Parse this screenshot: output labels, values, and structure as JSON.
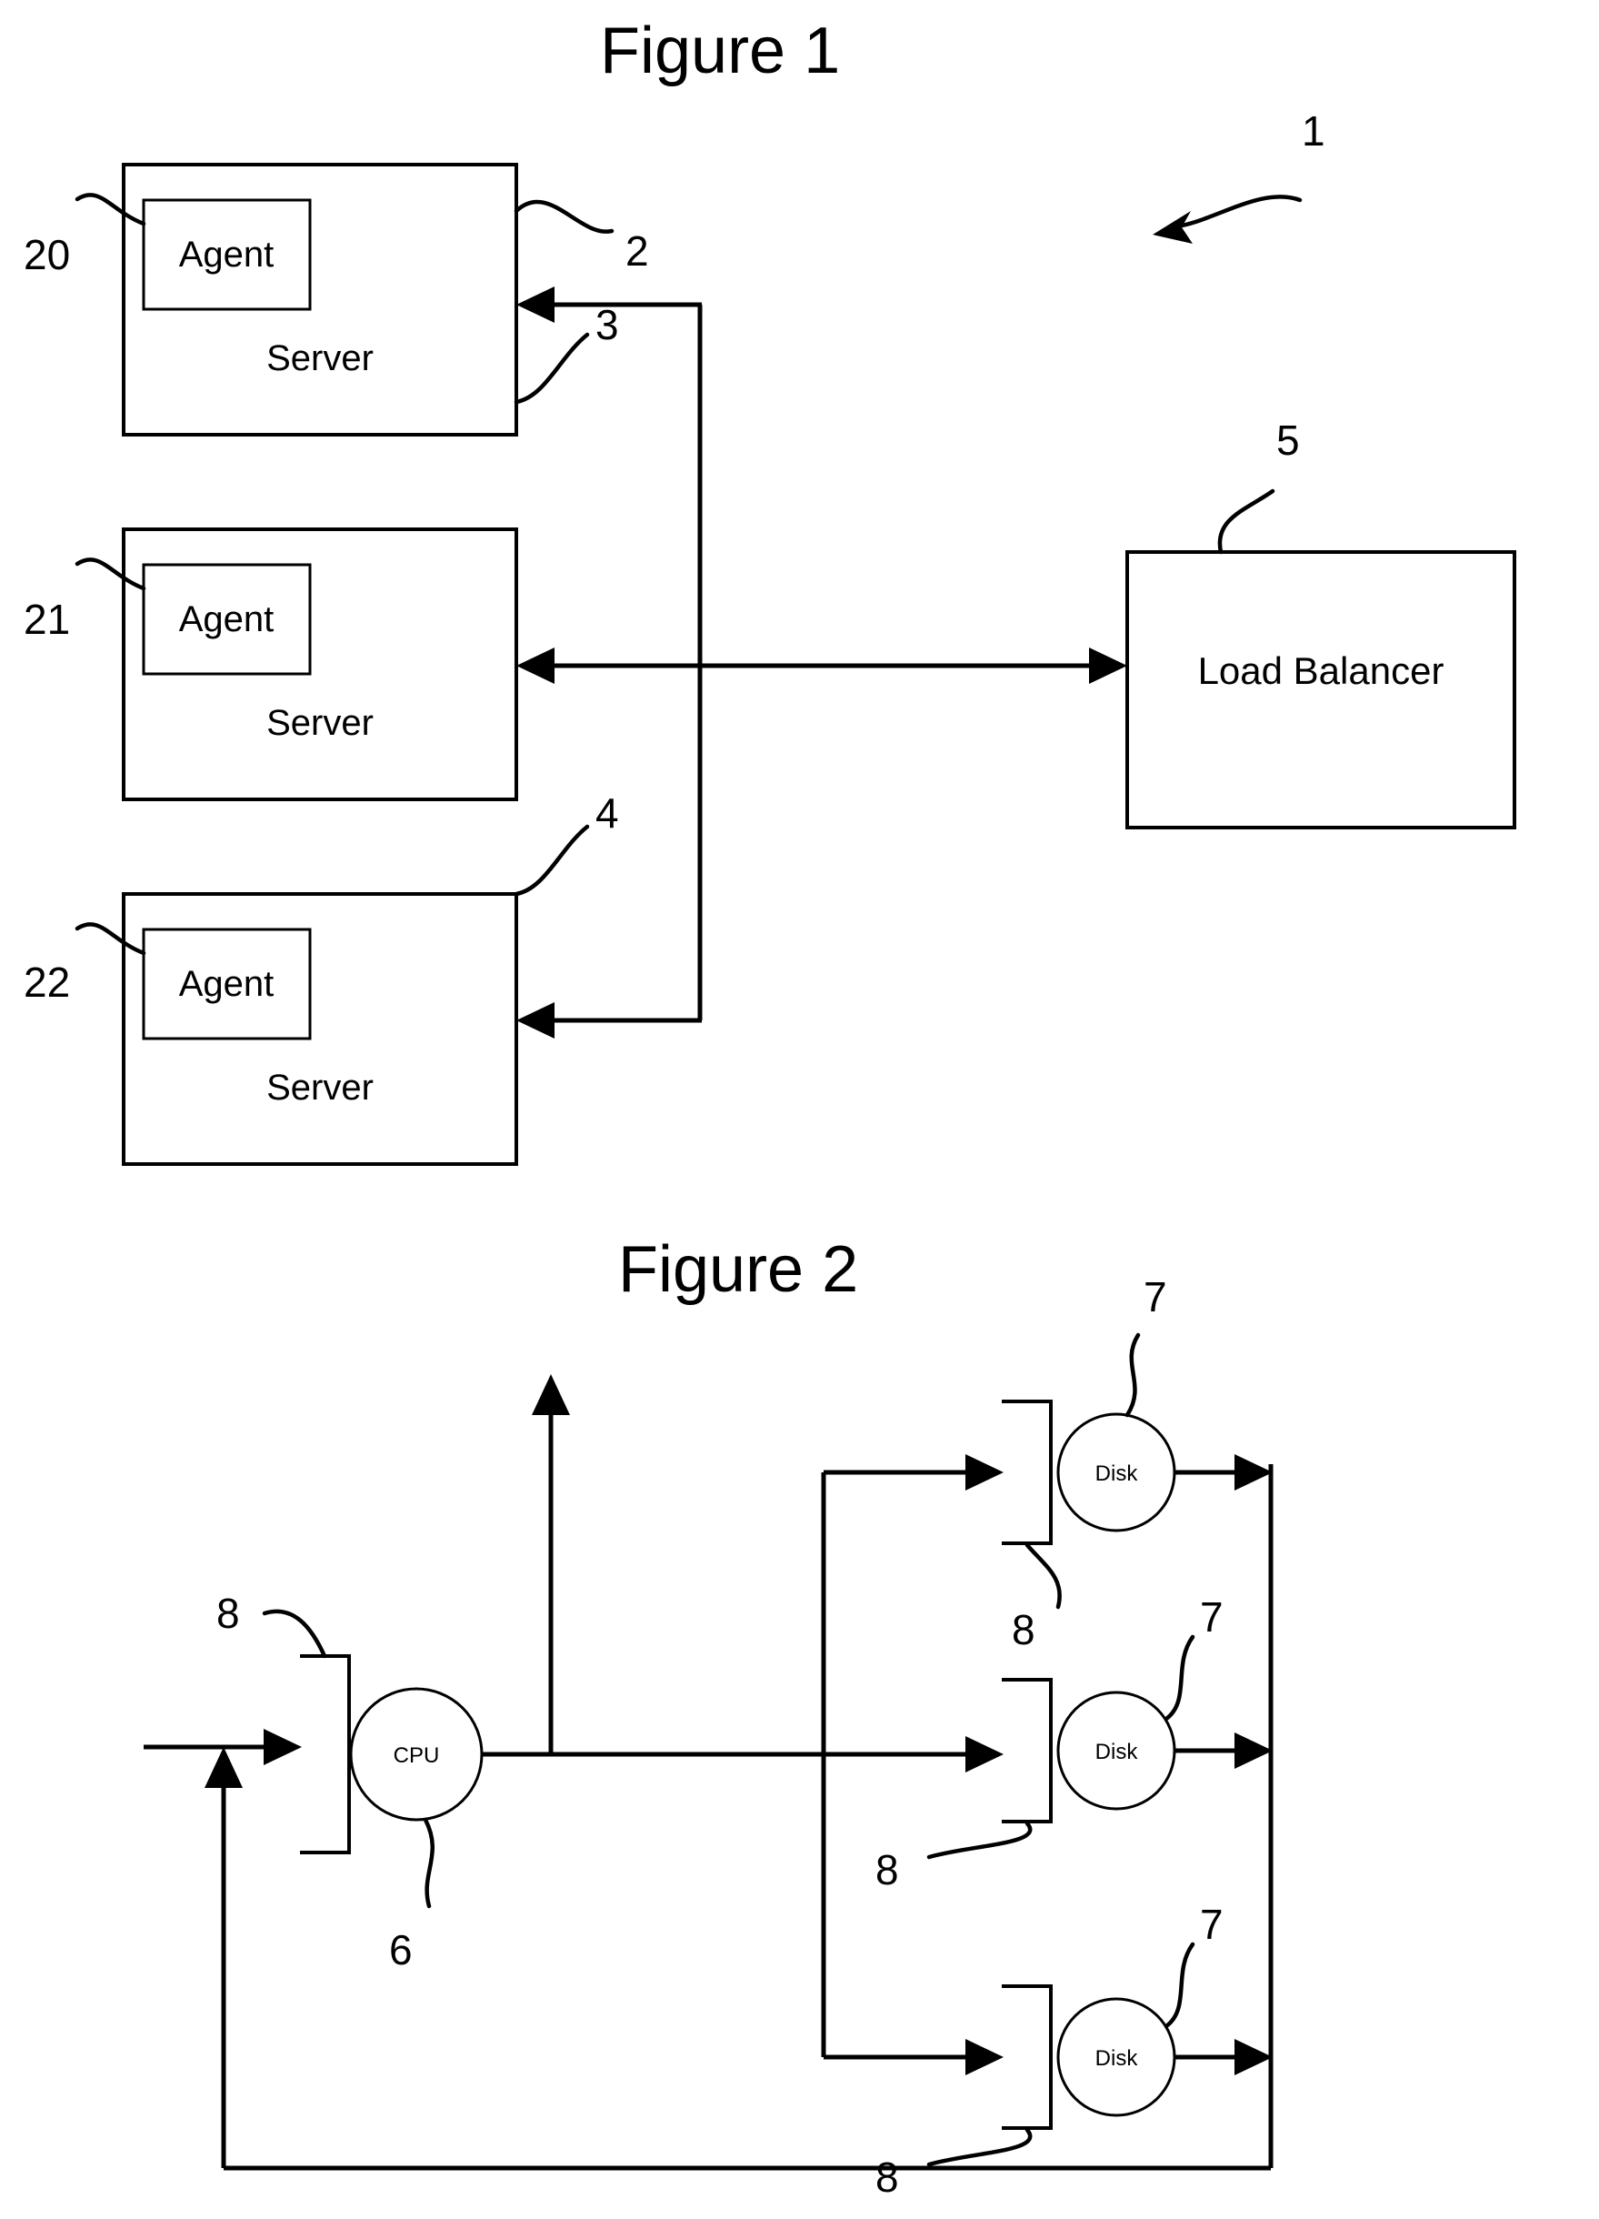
{
  "document": {
    "type": "patent-figure-sheet",
    "background_color": "#ffffff",
    "ink_color": "#000000"
  },
  "figure1": {
    "title": "Figure 1",
    "system_ref": "1",
    "servers": [
      {
        "box_label": "Server",
        "agent_label": "Agent",
        "left_ref": "20",
        "right_ref": "2"
      },
      {
        "box_label": "Server",
        "agent_label": "Agent",
        "left_ref": "21",
        "right_ref": "3"
      },
      {
        "box_label": "Server",
        "agent_label": "Agent",
        "left_ref": "22",
        "right_ref": "4"
      }
    ],
    "load_balancer": {
      "label": "Load Balancer",
      "ref": "5"
    }
  },
  "figure2": {
    "title": "Figure 2",
    "cpu": {
      "label": "CPU",
      "ref": "6",
      "queue_ref": "8"
    },
    "disks": [
      {
        "label": "Disk",
        "ref": "7",
        "queue_ref": "8"
      },
      {
        "label": "Disk",
        "ref": "7",
        "queue_ref": "8"
      },
      {
        "label": "Disk",
        "ref": "7",
        "queue_ref": "8"
      }
    ]
  }
}
